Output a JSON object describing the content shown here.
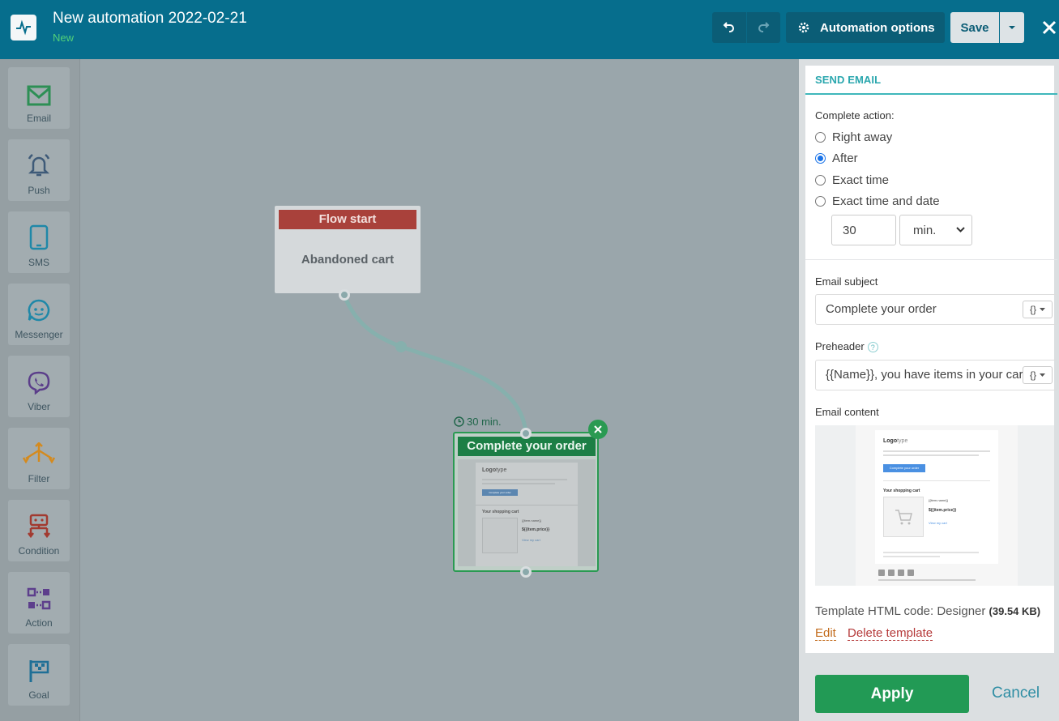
{
  "header": {
    "title": "New automation 2022-02-21",
    "status": "New",
    "options_label": "Automation options",
    "save_label": "Save"
  },
  "sidebar": {
    "items": [
      {
        "label": "Email",
        "icon": "envelope-icon"
      },
      {
        "label": "Push",
        "icon": "bell-icon"
      },
      {
        "label": "SMS",
        "icon": "phone-icon"
      },
      {
        "label": "Messenger",
        "icon": "chat-icon"
      },
      {
        "label": "Viber",
        "icon": "viber-icon"
      },
      {
        "label": "Filter",
        "icon": "filter-icon"
      },
      {
        "label": "Condition",
        "icon": "condition-icon"
      },
      {
        "label": "Action",
        "icon": "action-icon"
      },
      {
        "label": "Goal",
        "icon": "flag-icon"
      }
    ]
  },
  "canvas": {
    "start_node": {
      "header": "Flow start",
      "body": "Abandoned cart"
    },
    "delay_label": "30 min.",
    "email_node": {
      "header": "Complete your order"
    },
    "mini_preview": {
      "logo_a": "Logo",
      "logo_b": "type",
      "button": "Complete your order",
      "cart_title": "Your shopping cart",
      "item_name": "{{item.name}}",
      "item_price": "${{item.price}}",
      "view": "View my cart"
    }
  },
  "panel": {
    "title": "SEND EMAIL",
    "complete_action_label": "Complete action:",
    "options": [
      {
        "label": "Right away",
        "selected": false
      },
      {
        "label": "After",
        "selected": true
      },
      {
        "label": "Exact time",
        "selected": false
      },
      {
        "label": "Exact time and date",
        "selected": false
      }
    ],
    "delay_value": "30",
    "delay_unit": "min.",
    "subject_label": "Email subject",
    "subject_value": "Complete your order",
    "preheader_label": "Preheader",
    "preheader_value": "{{Name}}, you have items in your cart",
    "content_label": "Email content",
    "var_button": "{}",
    "template_prefix": "Template HTML code: ",
    "template_name": "Designer",
    "template_size": "(39.54 KB)",
    "edit_link": "Edit",
    "delete_link": "Delete template"
  },
  "footer": {
    "apply_label": "Apply",
    "cancel_label": "Cancel"
  },
  "colors": {
    "header_bg": "#066e8d",
    "flow_start": "#a9413b",
    "email_node": "#1c7f45",
    "apply": "#229a55",
    "accent": "#2aa7ae"
  }
}
